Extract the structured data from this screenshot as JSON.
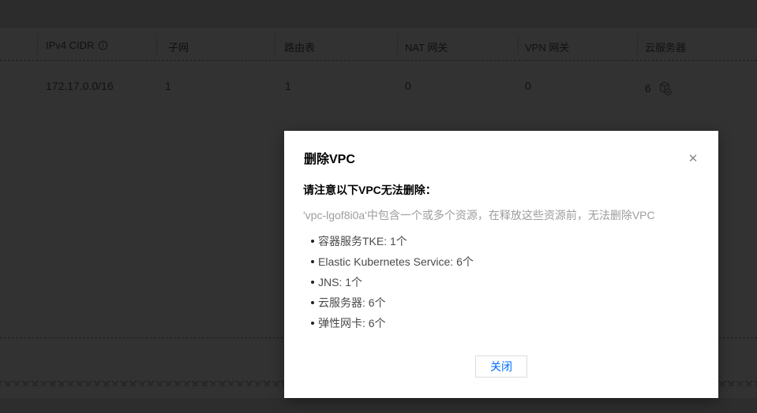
{
  "colors": {
    "accent": "#006eff"
  },
  "table": {
    "columns": [
      {
        "label": "IPv4 CIDR"
      },
      {
        "label": "子网"
      },
      {
        "label": "路由表"
      },
      {
        "label": "NAT 网关"
      },
      {
        "label": "VPN 网关"
      },
      {
        "label": "云服务器"
      }
    ],
    "row": [
      "172.17.0.0/16",
      "1",
      "1",
      "0",
      "0",
      "6"
    ]
  },
  "modal": {
    "title": "删除VPC",
    "close_icon": "✕",
    "notice": "请注意以下VPC无法删除：",
    "description": "'vpc-lgof8i0a'中包含一个或多个资源，在释放这些资源前，无法删除VPC",
    "resources": [
      "容器服务TKE: 1个",
      "Elastic Kubernetes Service: 6个",
      "JNS: 1个",
      "云服务器: 6个",
      "弹性网卡: 6个"
    ],
    "close_button": "关闭"
  }
}
